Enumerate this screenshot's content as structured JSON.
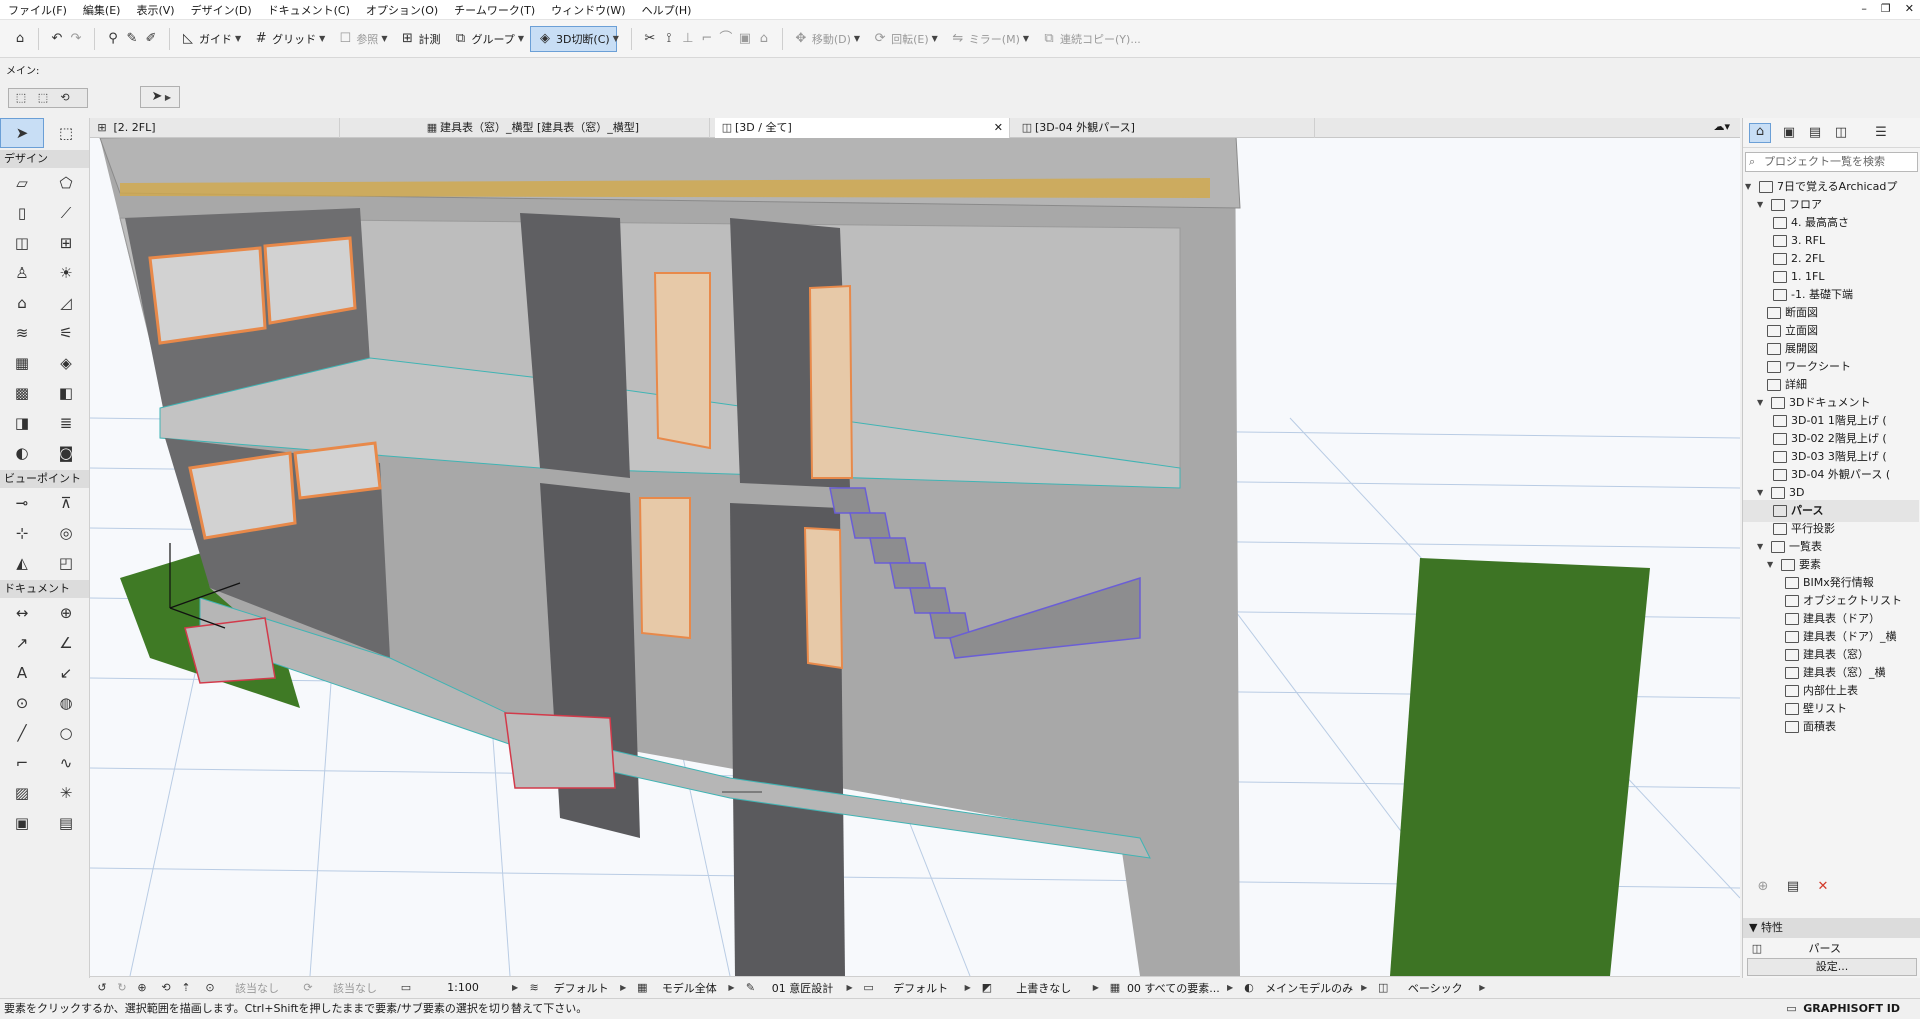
{
  "menu": [
    "ファイル(F)",
    "編集(E)",
    "表示(V)",
    "デザイン(D)",
    "ドキュメント(C)",
    "オプション(O)",
    "チームワーク(T)",
    "ウィンドウ(W)",
    "ヘルプ(H)"
  ],
  "toolbar": {
    "guide": "ガイド",
    "grid": "グリッド",
    "reference": "参照",
    "measure": "計測",
    "group": "グループ",
    "cut3d": "3D切断(C)",
    "move": "移動(D)",
    "rotate": "回転(E)",
    "mirror": "ミラー(M)",
    "multiply": "連続コピー(Y)..."
  },
  "info": {
    "main_label": "メイン:"
  },
  "toolbox": {
    "design": "デザイン",
    "viewpoint": "ビューポイント",
    "document": "ドキュメント"
  },
  "tabs": [
    "[2. 2FL]",
    "建具表（窓）_横型 [建具表（窓）_横型]",
    "[3D / 全て]",
    "[3D-04 外観パース]"
  ],
  "navigator": {
    "search_placeholder": "プロジェクト一覧を検索",
    "items": [
      {
        "label": "7日で覚えるArchicadプ"
      },
      {
        "label": "フロア"
      },
      {
        "label": "4. 最高高さ"
      },
      {
        "label": "3. RFL"
      },
      {
        "label": "2. 2FL"
      },
      {
        "label": "1. 1FL"
      },
      {
        "label": "-1. 基礎下端"
      },
      {
        "label": "断面図"
      },
      {
        "label": "立面図"
      },
      {
        "label": "展開図"
      },
      {
        "label": "ワークシート"
      },
      {
        "label": "詳細"
      },
      {
        "label": "3Dドキュメント"
      },
      {
        "label": "3D-01 1階見上げ ("
      },
      {
        "label": "3D-02 2階見上げ ("
      },
      {
        "label": "3D-03 3階見上げ ("
      },
      {
        "label": "3D-04 外観パース ("
      },
      {
        "label": "3D"
      },
      {
        "label": "パース"
      },
      {
        "label": "平行投影"
      },
      {
        "label": "一覧表"
      },
      {
        "label": "要素"
      },
      {
        "label": "BIMx発行情報"
      },
      {
        "label": "オブジェクトリスト"
      },
      {
        "label": "建具表（ドア）"
      },
      {
        "label": "建具表（ドア）_横"
      },
      {
        "label": "建具表（窓）"
      },
      {
        "label": "建具表（窓）_横"
      },
      {
        "label": "内部仕上表"
      },
      {
        "label": "壁リスト"
      },
      {
        "label": "面積表"
      }
    ],
    "properties_title": "特性",
    "properties_value": "パース",
    "settings_button": "設定..."
  },
  "bottombar": {
    "undo_zoom": "該当なし",
    "rotate_label": "該当なし",
    "scale": "1:100",
    "layer": "デフォルト",
    "model": "モデル全体",
    "view": "01 意匠設計",
    "pen": "デフォルト",
    "override": "上書きなし",
    "reno": "00 すべての要素...",
    "display": "メインモデルのみ",
    "style": "ベーシック"
  },
  "status": {
    "message": "要素をクリックするか、選択範囲を描画します。Ctrl+Shiftを押したままで要素/サブ要素の選択を切り替えて下さい。",
    "brand": "GRAPHISOFT ID"
  }
}
